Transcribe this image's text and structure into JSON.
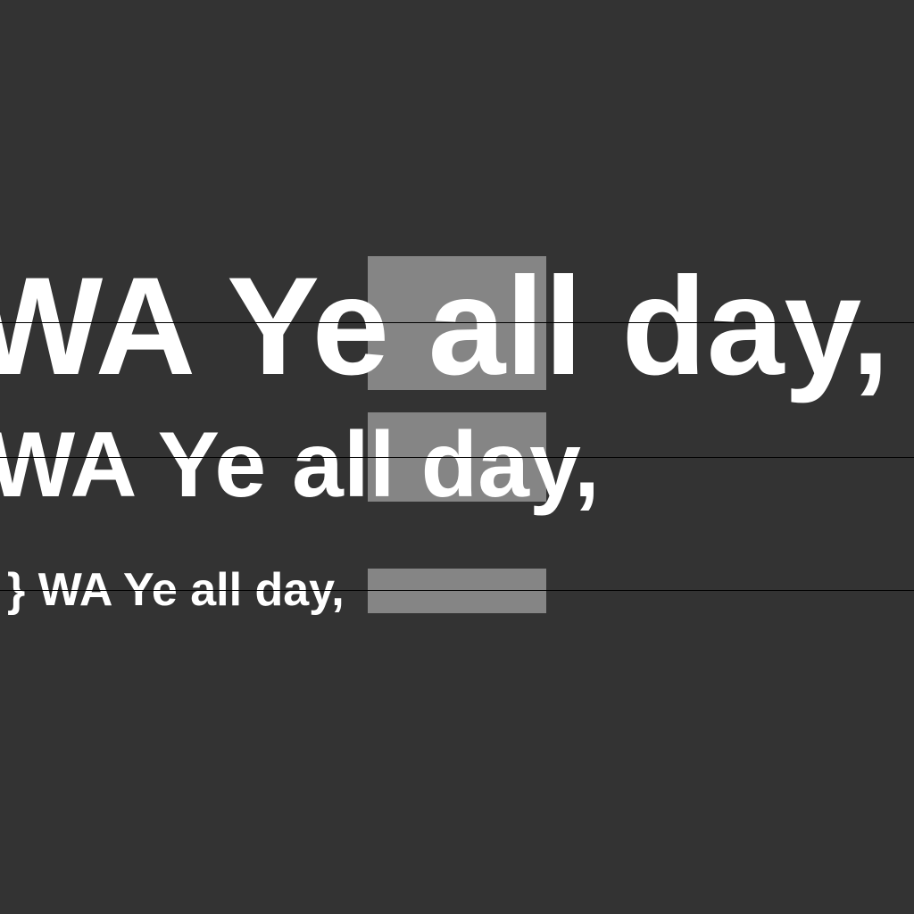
{
  "colors": {
    "background": "#333333",
    "highlight": "#858585",
    "baseline": "#000000",
    "text": "#ffffff"
  },
  "rows": [
    {
      "text": "WA Ye all day,"
    },
    {
      "text": "WA Ye all day,"
    },
    {
      "prefix": "}",
      "text": "WA Ye all day,"
    }
  ]
}
